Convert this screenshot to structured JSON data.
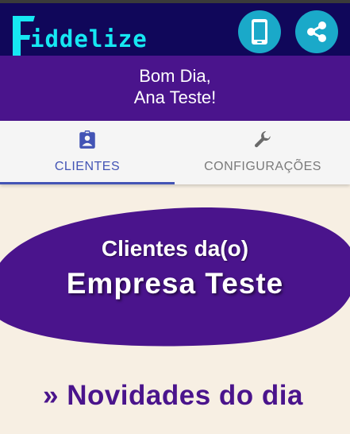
{
  "header": {
    "logo_letters": "iddelize",
    "logo_full": "Fiddelize",
    "phone_icon": "smartphone-icon",
    "share_icon": "share-icon",
    "accent_color": "#16e7f2"
  },
  "greeting": {
    "line1": "Bom Dia,",
    "line2": "Ana Teste!"
  },
  "tabs": [
    {
      "label": "CLIENTES",
      "icon": "assignment-ind-icon",
      "active": true
    },
    {
      "label": "CONFIGURAÇÕES",
      "icon": "wrench-icon",
      "active": false
    }
  ],
  "hero": {
    "line1": "Clientes da(o)",
    "line2": "Empresa Teste"
  },
  "news": {
    "title": "» Novidades do dia"
  },
  "colors": {
    "header_bg": "#10075a",
    "purple": "#4a148c",
    "tab_active": "#4354b5",
    "button": "#1aa9c9",
    "page_bg": "#f7efe3"
  }
}
